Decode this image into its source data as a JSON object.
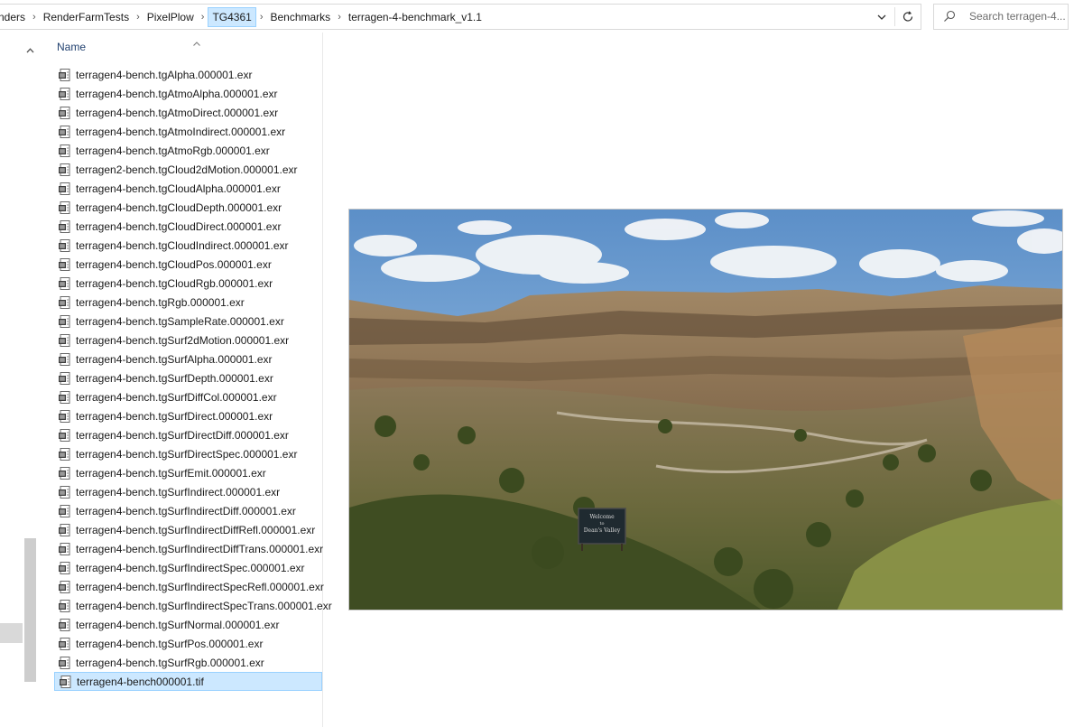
{
  "address_bar": {
    "crumbs": [
      {
        "label": "nders"
      },
      {
        "label": "RenderFarmTests"
      },
      {
        "label": "PixelPlow"
      },
      {
        "label": "TG4361"
      },
      {
        "label": "Benchmarks"
      },
      {
        "label": "terragen-4-benchmark_v1.1"
      }
    ],
    "highlighted_crumb": "TG4361"
  },
  "search": {
    "placeholder": "Search terragen-4..."
  },
  "file_list": {
    "column_header": "Name",
    "sort": "ascending",
    "files": [
      {
        "name": "terragen4-bench.tgAlpha.000001.exr"
      },
      {
        "name": "terragen4-bench.tgAtmoAlpha.000001.exr"
      },
      {
        "name": "terragen4-bench.tgAtmoDirect.000001.exr"
      },
      {
        "name": "terragen4-bench.tgAtmoIndirect.000001.exr"
      },
      {
        "name": "terragen4-bench.tgAtmoRgb.000001.exr"
      },
      {
        "name": "terragen2-bench.tgCloud2dMotion.000001.exr"
      },
      {
        "name": "terragen4-bench.tgCloudAlpha.000001.exr"
      },
      {
        "name": "terragen4-bench.tgCloudDepth.000001.exr"
      },
      {
        "name": "terragen4-bench.tgCloudDirect.000001.exr"
      },
      {
        "name": "terragen4-bench.tgCloudIndirect.000001.exr"
      },
      {
        "name": "terragen4-bench.tgCloudPos.000001.exr"
      },
      {
        "name": "terragen4-bench.tgCloudRgb.000001.exr"
      },
      {
        "name": "terragen4-bench.tgRgb.000001.exr"
      },
      {
        "name": "terragen4-bench.tgSampleRate.000001.exr"
      },
      {
        "name": "terragen4-bench.tgSurf2dMotion.000001.exr"
      },
      {
        "name": "terragen4-bench.tgSurfAlpha.000001.exr"
      },
      {
        "name": "terragen4-bench.tgSurfDepth.000001.exr"
      },
      {
        "name": "terragen4-bench.tgSurfDiffCol.000001.exr"
      },
      {
        "name": "terragen4-bench.tgSurfDirect.000001.exr"
      },
      {
        "name": "terragen4-bench.tgSurfDirectDiff.000001.exr"
      },
      {
        "name": "terragen4-bench.tgSurfDirectSpec.000001.exr"
      },
      {
        "name": "terragen4-bench.tgSurfEmit.000001.exr"
      },
      {
        "name": "terragen4-bench.tgSurfIndirect.000001.exr"
      },
      {
        "name": "terragen4-bench.tgSurfIndirectDiff.000001.exr"
      },
      {
        "name": "terragen4-bench.tgSurfIndirectDiffRefl.000001.exr"
      },
      {
        "name": "terragen4-bench.tgSurfIndirectDiffTrans.000001.exr"
      },
      {
        "name": "terragen4-bench.tgSurfIndirectSpec.000001.exr"
      },
      {
        "name": "terragen4-bench.tgSurfIndirectSpecRefl.000001.exr"
      },
      {
        "name": "terragen4-bench.tgSurfIndirectSpecTrans.000001.exr"
      },
      {
        "name": "terragen4-bench.tgSurfNormal.000001.exr"
      },
      {
        "name": "terragen4-bench.tgSurfPos.000001.exr"
      },
      {
        "name": "terragen4-bench.tgSurfRgb.000001.exr"
      },
      {
        "name": "terragen4-bench000001.tif",
        "selected": true
      }
    ]
  },
  "preview": {
    "sign_text": [
      "Welcome",
      "to",
      "Dean's Valley"
    ]
  },
  "colors": {
    "selection_bg": "#cce8ff",
    "selection_border": "#99d1ff",
    "header_text": "#1f3f6e"
  },
  "icons": {
    "file": "exr-file-icon",
    "dropdown": "chevron-down-icon",
    "refresh": "refresh-icon",
    "search": "search-icon",
    "sort": "sort-ascending-icon",
    "scroll_up": "scroll-up-arrow-icon"
  }
}
